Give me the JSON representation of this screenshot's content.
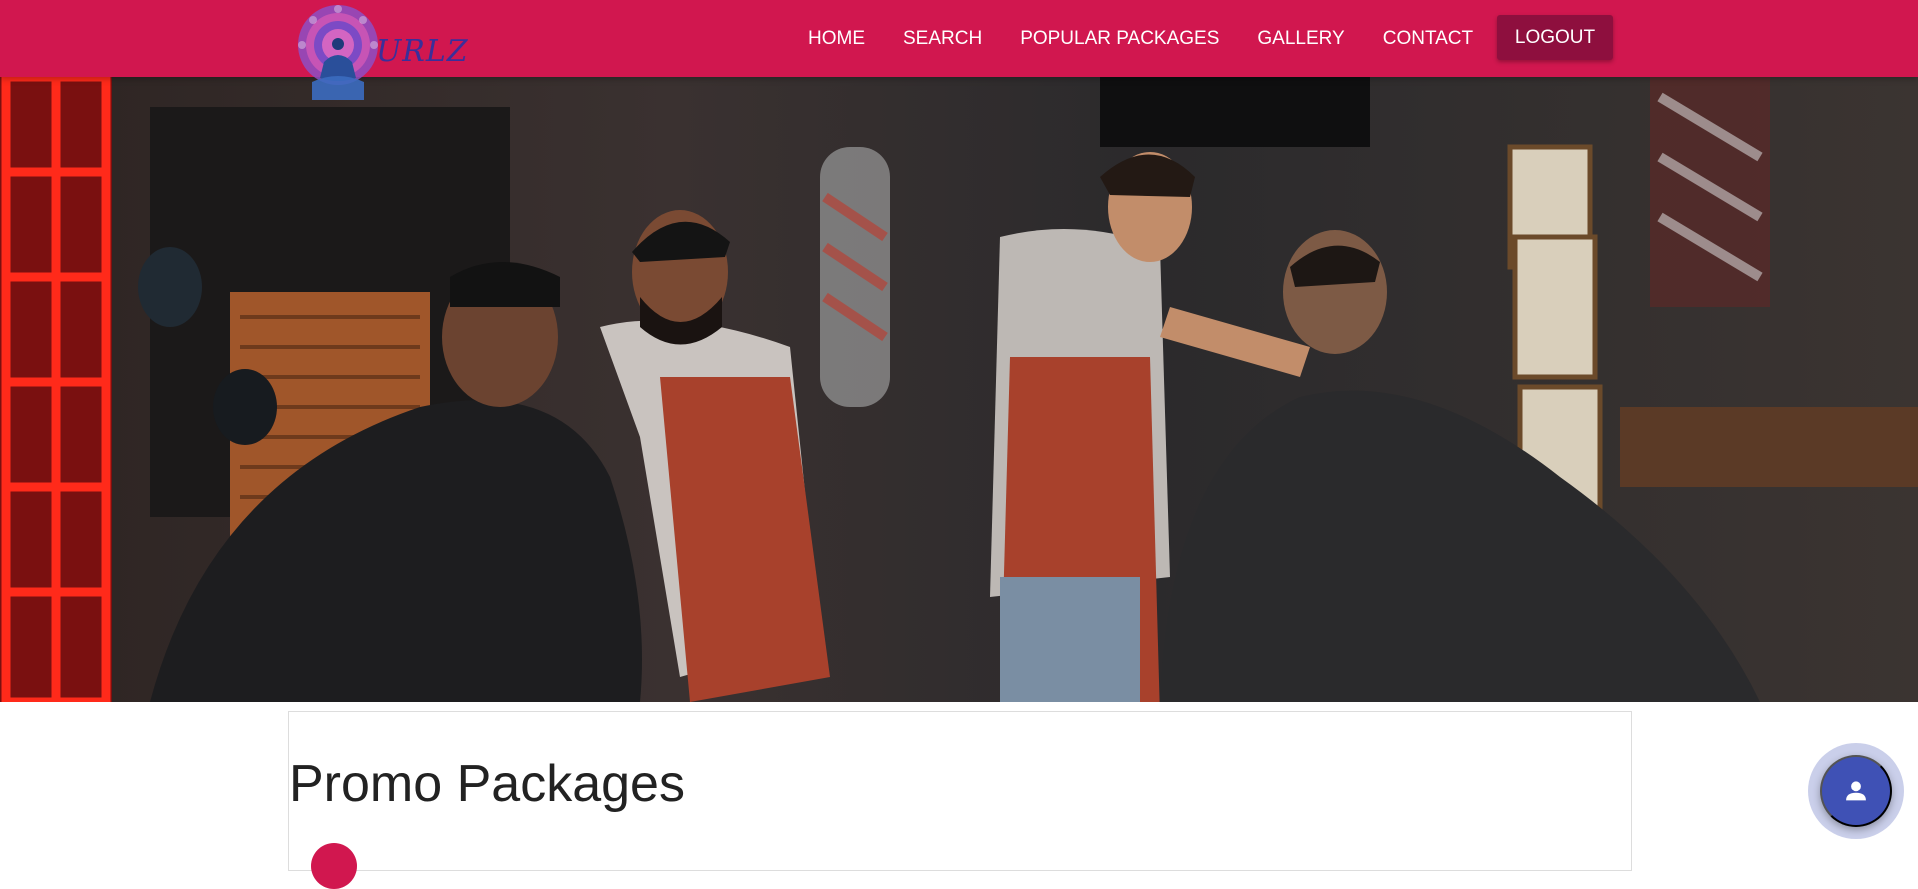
{
  "brand": {
    "logo_text": "URLZ"
  },
  "nav": {
    "items": [
      {
        "label": "HOME"
      },
      {
        "label": "SEARCH"
      },
      {
        "label": "POPULAR PACKAGES"
      },
      {
        "label": "GALLERY"
      },
      {
        "label": "CONTACT"
      }
    ],
    "logout_label": "LOGOUT"
  },
  "main": {
    "section_title": "Promo Packages"
  },
  "icons": {
    "fab": "person-icon",
    "logo": "mandala-logo-icon"
  },
  "colors": {
    "navbar": "#d1174f",
    "logout_button": "#8e0f3e",
    "fab": "#3f51b5",
    "text": "#222222"
  }
}
